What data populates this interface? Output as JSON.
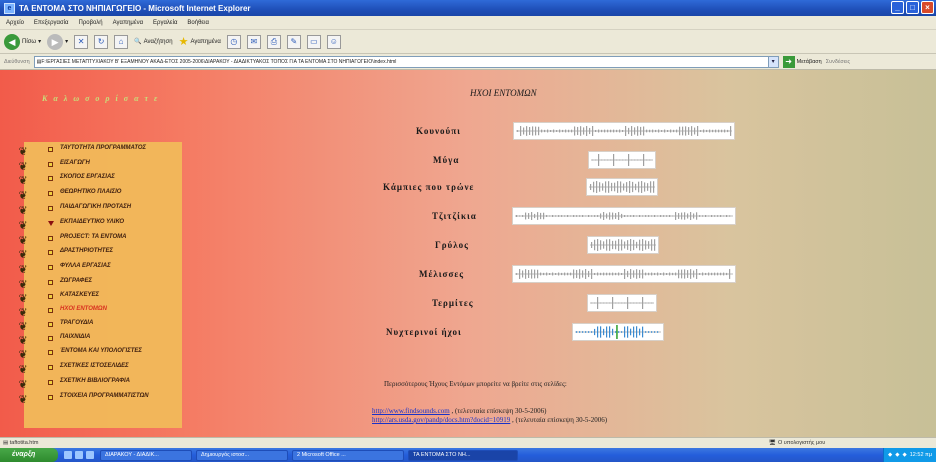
{
  "window": {
    "title": "ΤΑ ΕΝΤΟΜΑ ΣΤΟ ΝΗΠΙΑΓΩΓΕΙΟ - Microsoft Internet Explorer",
    "controls": [
      "_",
      "□",
      "×"
    ]
  },
  "menu": [
    "Αρχείο",
    "Επεξεργασία",
    "Προβολή",
    "Αγαπημένα",
    "Εργαλεία",
    "Βοήθεια"
  ],
  "toolbar": {
    "back": "Πίσω",
    "search": "Αναζήτηση",
    "favorites": "Αγαπημένα"
  },
  "address": {
    "label": "Διεύθυνση",
    "value": "F:\\ΕΡΓΑΣΙΕΣ ΜΕΤΑΠΤΥΧΙΑΚΟΥ Β' ΕΞΑΜΗΝΟΥ ΑΚΑΔ-ΕΤΟΣ 2005-2006\\ΔΙΑΡΑΚΟΥ - ΔΙΑΔΙΚΤΥΑΚΟΣ ΤΟΠΟΣ ΓΙΑ ΤΑ ΕΝΤΟΜΑ ΣΤΟ ΝΗΠΙΑΓΩΓΕΙΟ\\index.html",
    "go": "Μετάβαση",
    "links": "Συνδέσεις"
  },
  "sidebar": {
    "title": "Κ α λ ω σ ο ρ ί σ α τ ε",
    "items": [
      {
        "label": "ΤΑΥΤΟΤΗΤΑ ΠΡΟΓΡΑΜΜΑΤΟΣ",
        "active": false
      },
      {
        "label": "ΕΙΣΑΓΩΓΗ",
        "active": false
      },
      {
        "label": "ΣΚΟΠΟΣ ΕΡΓΑΣΙΑΣ",
        "active": false
      },
      {
        "label": "ΘΕΩΡΗΤΙΚΟ ΠΛΑΙΣΙΟ",
        "active": false
      },
      {
        "label": "ΠΑΙΔΑΓΩΓΙΚΗ ΠΡΟΤΑΣΗ",
        "active": false
      },
      {
        "label": "ΕΚΠΑΙΔΕΥΤΙΚΟ ΥΛΙΚΟ",
        "active": false
      },
      {
        "label": "PROJECT: ΤΑ ΕΝΤΟΜΑ",
        "active": false
      },
      {
        "label": "ΔΡΑΣΤΗΡΙΟΤΗΤΕΣ",
        "active": false
      },
      {
        "label": "ΦΥΛΛΑ ΕΡΓΑΣΙΑΣ",
        "active": false
      },
      {
        "label": "ΖΩΓΡΑΦΕΣ",
        "active": false
      },
      {
        "label": "ΚΑΤΑΣΚΕΥΕΣ",
        "active": false
      },
      {
        "label": "ΗΧΟΙ ΕΝΤΟΜΩΝ",
        "active": true
      },
      {
        "label": "ΤΡΑΓΟΥΔΙΑ",
        "active": false
      },
      {
        "label": "ΠΑΙΧΝΙΔΙΑ",
        "active": false
      },
      {
        "label": "ΈΝΤΟΜΑ ΚΑΙ ΥΠΟΛΟΓΙΣΤΕΣ",
        "active": false
      },
      {
        "label": "ΣΧΕΤΙΚΕΣ ΙΣΤΟΣΕΛΙΔΕΣ",
        "active": false
      },
      {
        "label": "ΣΧΕΤΙΚΗ ΒΙΒΛΙΟΓΡΑΦΙΑ",
        "active": false
      },
      {
        "label": "ΣΤΟΙΧΕΙΑ ΠΡΟΓΡΑΜΜΑΤΙΣΤΩΝ",
        "active": false
      }
    ]
  },
  "main": {
    "title": "ΗΧΟΙ ΕΝΤΟΜΩΝ",
    "sounds": [
      {
        "label": "Κουνούπι"
      },
      {
        "label": "Μύγα"
      },
      {
        "label": "Κάμπιες που τρώνε"
      },
      {
        "label": "Τζιτζίκια"
      },
      {
        "label": "Γρύλος"
      },
      {
        "label": "Μέλισσες"
      },
      {
        "label": "Τερμίτες"
      },
      {
        "label": "Νυχτερινοί ήχοι"
      }
    ],
    "caption": "Περισσότερους Ήχους Εντόμων μπορείτε να βρείτε στις σελίδες:",
    "links": [
      {
        "url": "http://www.findsounds.com",
        "note": " , (τελευταία επίσκεψη 30-5-2006)"
      },
      {
        "url": "http://ars.usda.gov/pandp/docs.htm?docid=10919",
        "note": " , (τελευταία επίσκεψη 30-5-2006)"
      }
    ]
  },
  "status": {
    "left": "taftotita.htm",
    "zone": "Ο υπολογιστής μου"
  },
  "taskbar": {
    "start": "έναρξη",
    "tasks": [
      "ΔΙΑΡΑΚΟΥ - ΔΙΑΔΙΚ...",
      "Δημιουργός ιστοσ...",
      "2 Microsoft Office ...",
      "ΤΑ ΕΝΤΟΜΑ ΣΤΟ ΝΗ..."
    ],
    "clock": "12:52 πμ"
  }
}
